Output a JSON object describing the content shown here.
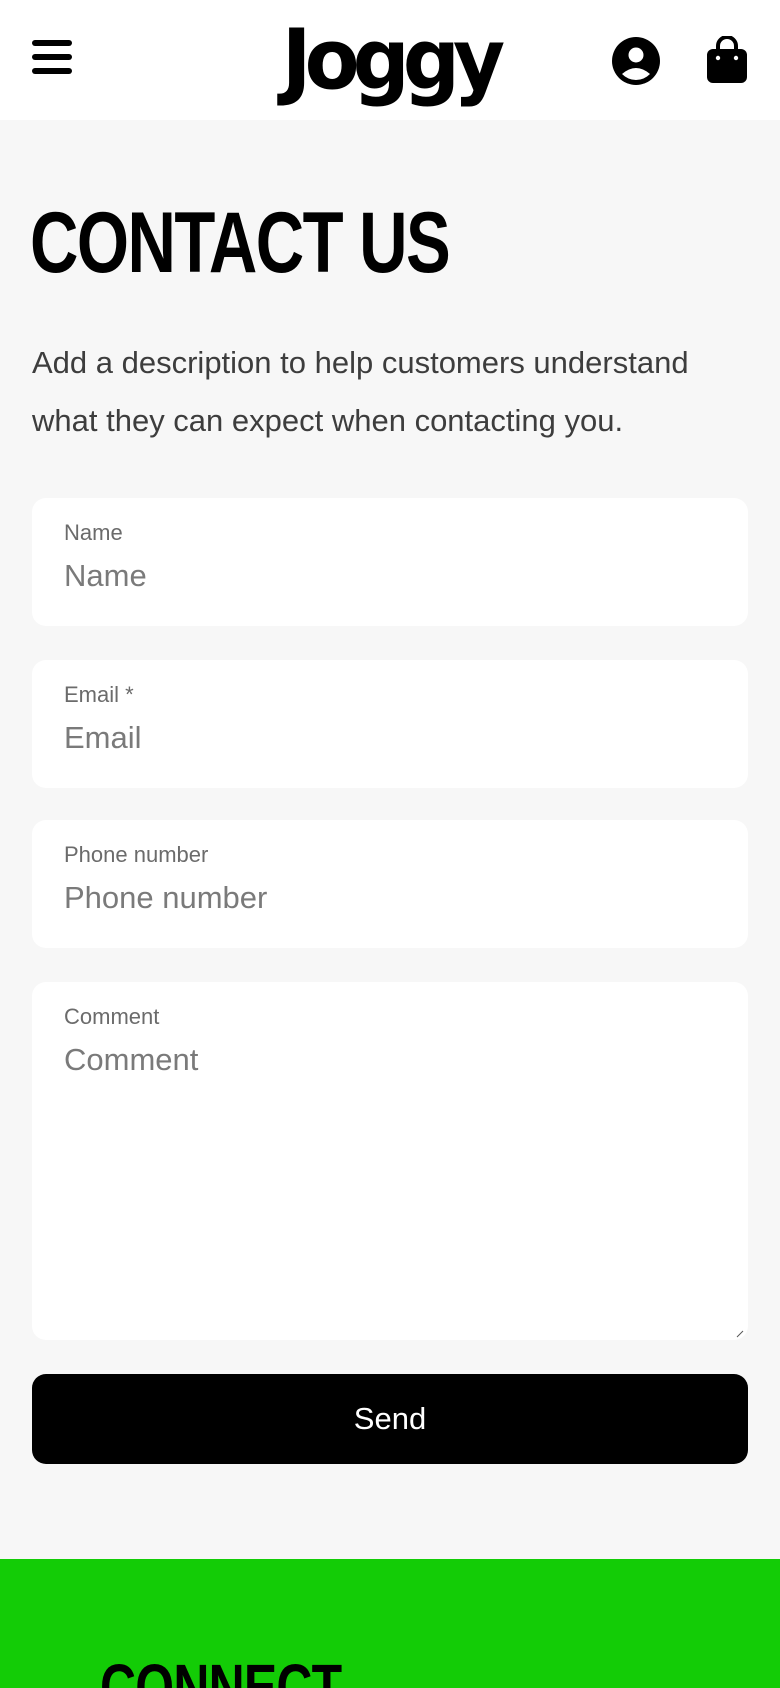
{
  "header": {
    "logo_text": "Joggy",
    "menu_icon": "hamburger-menu-icon",
    "account_icon": "user-account-icon",
    "cart_icon": "shopping-bag-icon"
  },
  "main": {
    "title": "CONTACT US",
    "description": "Add a description to help customers understand what they can expect when contacting you."
  },
  "form": {
    "name": {
      "label": "Name",
      "placeholder": "Name",
      "value": ""
    },
    "email": {
      "label": "Email *",
      "placeholder": "Email",
      "value": ""
    },
    "phone": {
      "label": "Phone number",
      "placeholder": "Phone number",
      "value": ""
    },
    "comment": {
      "label": "Comment",
      "placeholder": "Comment",
      "value": ""
    },
    "submit_label": "Send"
  },
  "footer": {
    "heading": "CONNECT"
  },
  "colors": {
    "page_background": "#f7f7f7",
    "footer_background": "#13cc06",
    "button_background": "#000000",
    "button_text": "#ffffff"
  }
}
